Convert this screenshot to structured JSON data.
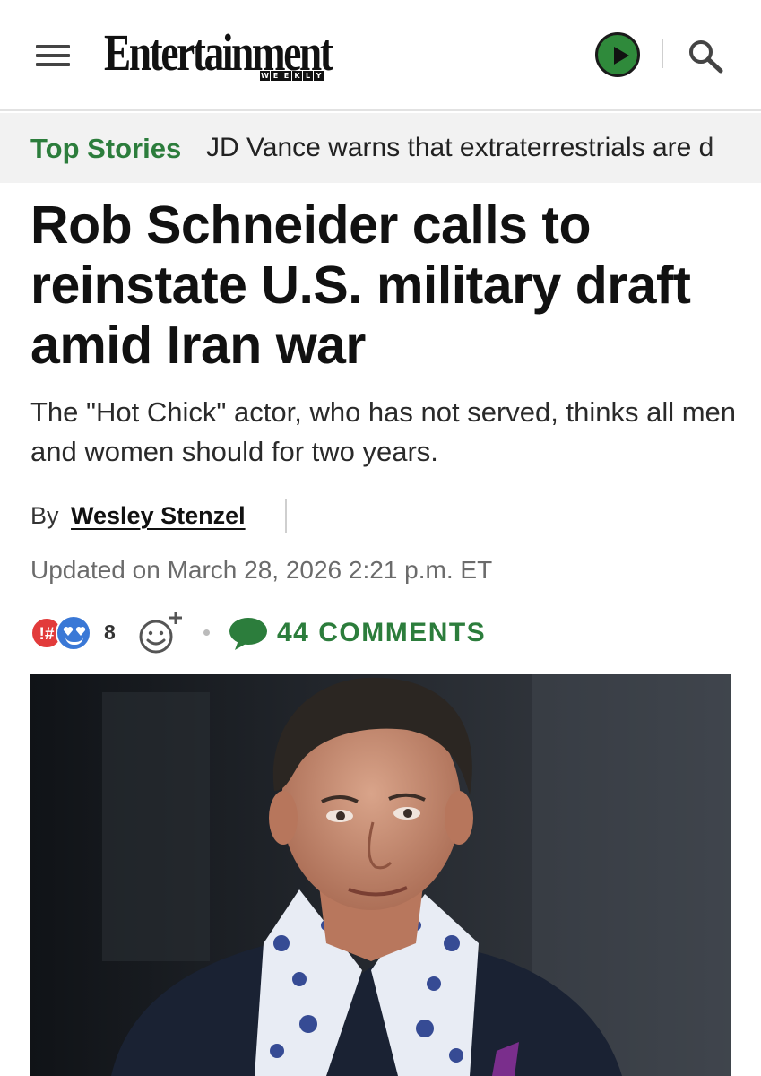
{
  "header": {
    "logo_text": "Entertainment",
    "logo_sub": [
      "W",
      "E",
      "E",
      "K",
      "L",
      "Y"
    ],
    "menu_icon": "hamburger-menu-icon",
    "play_icon": "play-icon",
    "search_icon": "search-icon",
    "brand_color": "#2c7d3c"
  },
  "top_stories": {
    "label": "Top Stories",
    "story": "JD Vance warns that extraterrestrials are d"
  },
  "article": {
    "headline": "Rob Schneider calls to reinstate U.S. military draft amid Iran war",
    "dek": "The \"Hot Chick\" actor, who has not served, thinks all men and women should for two years.",
    "byline_prefix": "By",
    "author": "Wesley Stenzel",
    "updated": "Updated on March 28, 2026 2:21 p.m. ET"
  },
  "reactions": {
    "badge_a": "!#",
    "badge_b_icon": "heart-eyes-emoji-icon",
    "count": "8",
    "add_reaction_icon": "add-reaction-smiley-icon",
    "comments_icon": "speech-bubble-icon",
    "comments_label": "44 COMMENTS"
  },
  "hero_image": {
    "description_icon": "article-photo"
  }
}
